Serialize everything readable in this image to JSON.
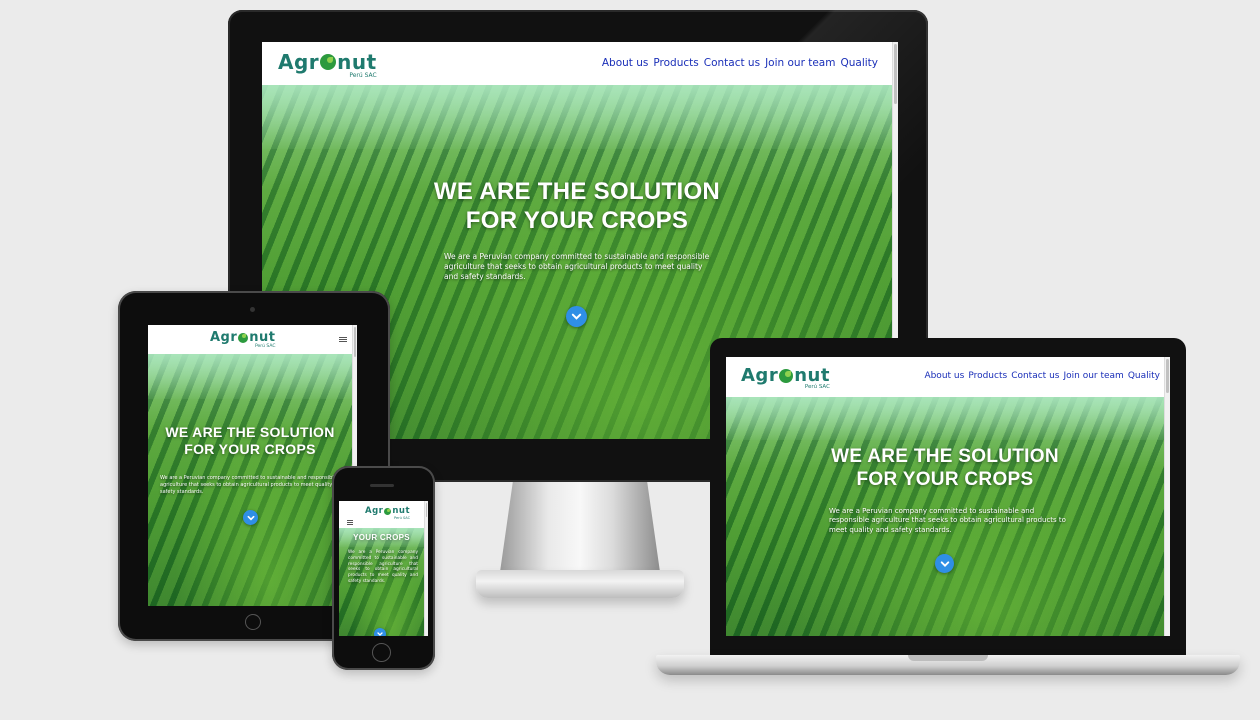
{
  "site": {
    "logo_text_a": "Agr",
    "logo_text_b": "nut",
    "logo_sub": "Perú SAC",
    "nav": [
      "About us",
      "Products",
      "Contact us",
      "Join our team",
      "Quality"
    ],
    "hero_title_line1": "WE ARE THE SOLUTION",
    "hero_title_line2": "FOR YOUR CROPS",
    "hero_text": "We are a Peruvian company committed to sustainable and responsible agriculture that seeks to obtain agricultural products to meet quality and safety standards.",
    "phone_title": "YOUR CROPS",
    "scroll_icon": "chevron-down-icon",
    "menu_icon": "hamburger-menu-icon"
  },
  "colors": {
    "nav_link": "#1a2fb8",
    "logo": "#1f7a6e",
    "scroll_button": "#2f8fe6"
  }
}
